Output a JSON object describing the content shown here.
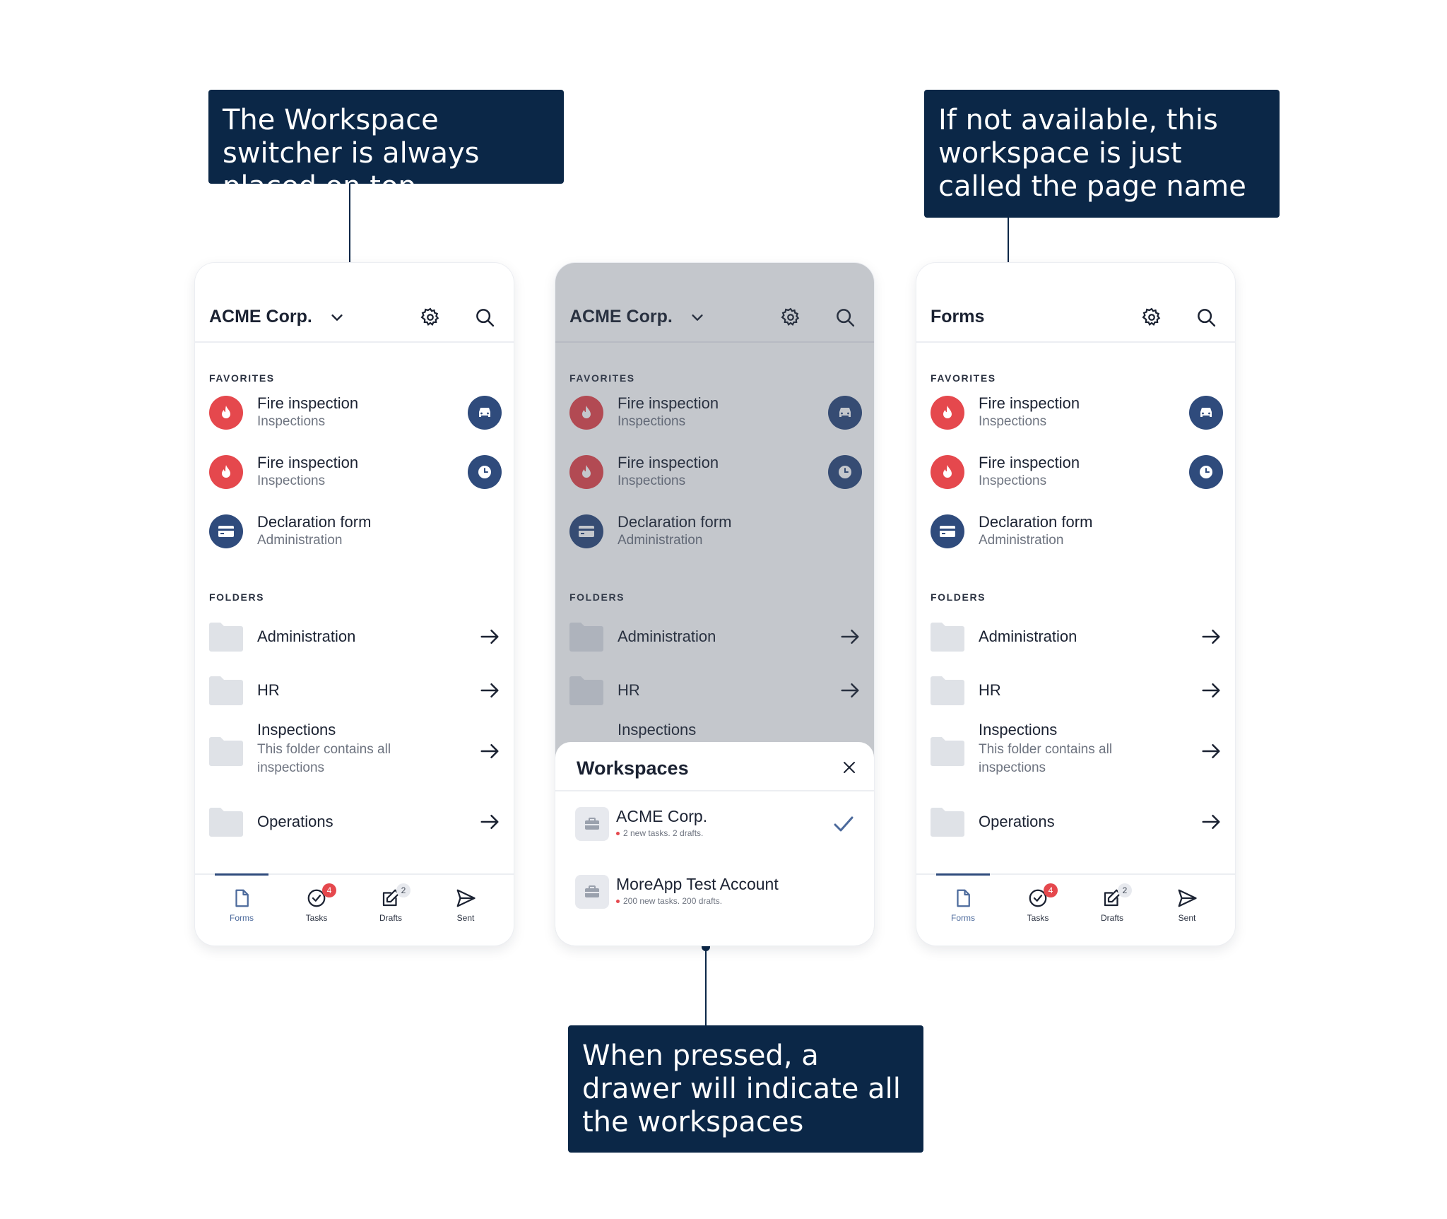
{
  "callouts": {
    "top_left": "The Workspace switcher is always placed on top",
    "top_right": "If not available, this workspace is just called the page name",
    "bottom": "When pressed, a drawer will indicate all the workspaces"
  },
  "phones": {
    "left": {
      "title": "ACME Corp."
    },
    "middle": {
      "title": "ACME Corp."
    },
    "right": {
      "title": "Forms"
    }
  },
  "sections": {
    "favorites": "FAVORITES",
    "folders": "FOLDERS"
  },
  "favorites": [
    {
      "title": "Fire inspection",
      "subtitle": "Inspections",
      "icon": "flame-icon",
      "action_icon": "car-icon"
    },
    {
      "title": "Fire inspection",
      "subtitle": "Inspections",
      "icon": "flame-icon",
      "action_icon": "clock-icon"
    },
    {
      "title": "Declaration form",
      "subtitle": "Administration",
      "icon": "card-icon",
      "action_icon": ""
    }
  ],
  "folders": [
    {
      "title": "Administration",
      "description": ""
    },
    {
      "title": "HR",
      "description": ""
    },
    {
      "title": "Inspections",
      "description": "This folder contains all inspections"
    },
    {
      "title": "Operations",
      "description": ""
    }
  ],
  "tabs": [
    {
      "label": "Forms",
      "icon": "document-icon",
      "badge": ""
    },
    {
      "label": "Tasks",
      "icon": "check-circle-icon",
      "badge": "4"
    },
    {
      "label": "Drafts",
      "icon": "edit-icon",
      "badge": "2"
    },
    {
      "label": "Sent",
      "icon": "send-icon",
      "badge": ""
    }
  ],
  "drawer": {
    "title": "Workspaces",
    "workspaces": [
      {
        "name": "ACME Corp.",
        "meta": "2 new tasks. 2 drafts.",
        "selected": true
      },
      {
        "name": "MoreApp Test Account",
        "meta": "200 new tasks. 200 drafts.",
        "selected": false
      }
    ]
  },
  "colors": {
    "callout_bg": "#0b2747",
    "accent": "#2f4b7c",
    "fire": "#e5484d",
    "badge_red": "#e5484d"
  }
}
